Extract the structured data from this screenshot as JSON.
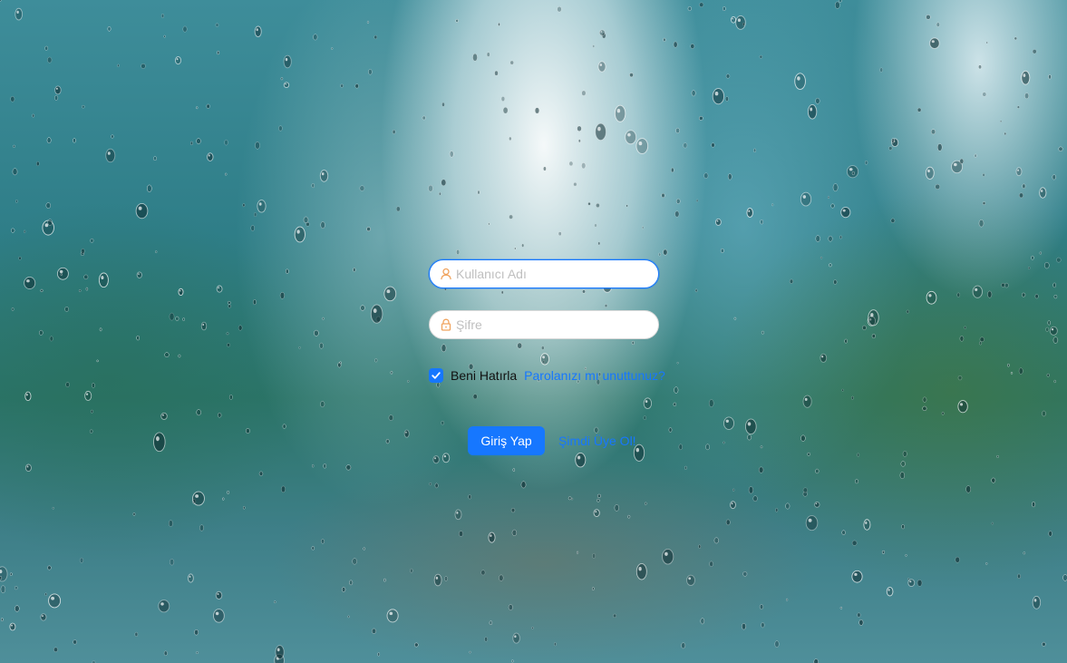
{
  "login": {
    "username_placeholder": "Kullanıcı Adı",
    "username_value": "",
    "password_placeholder": "Şifre",
    "password_value": "",
    "remember_label": "Beni Hatırla",
    "remember_checked": true,
    "forgot_password": "Parolanızı mı unuttunuz?",
    "login_button": "Giriş Yap",
    "register_link": "Şimdi Üye Ol!"
  },
  "colors": {
    "primary": "#1677ff",
    "icon_accent": "#f0a35e",
    "placeholder": "#bfbfbf"
  },
  "icons": {
    "username": "user-icon",
    "password": "lock-icon",
    "checkbox": "check-icon"
  }
}
